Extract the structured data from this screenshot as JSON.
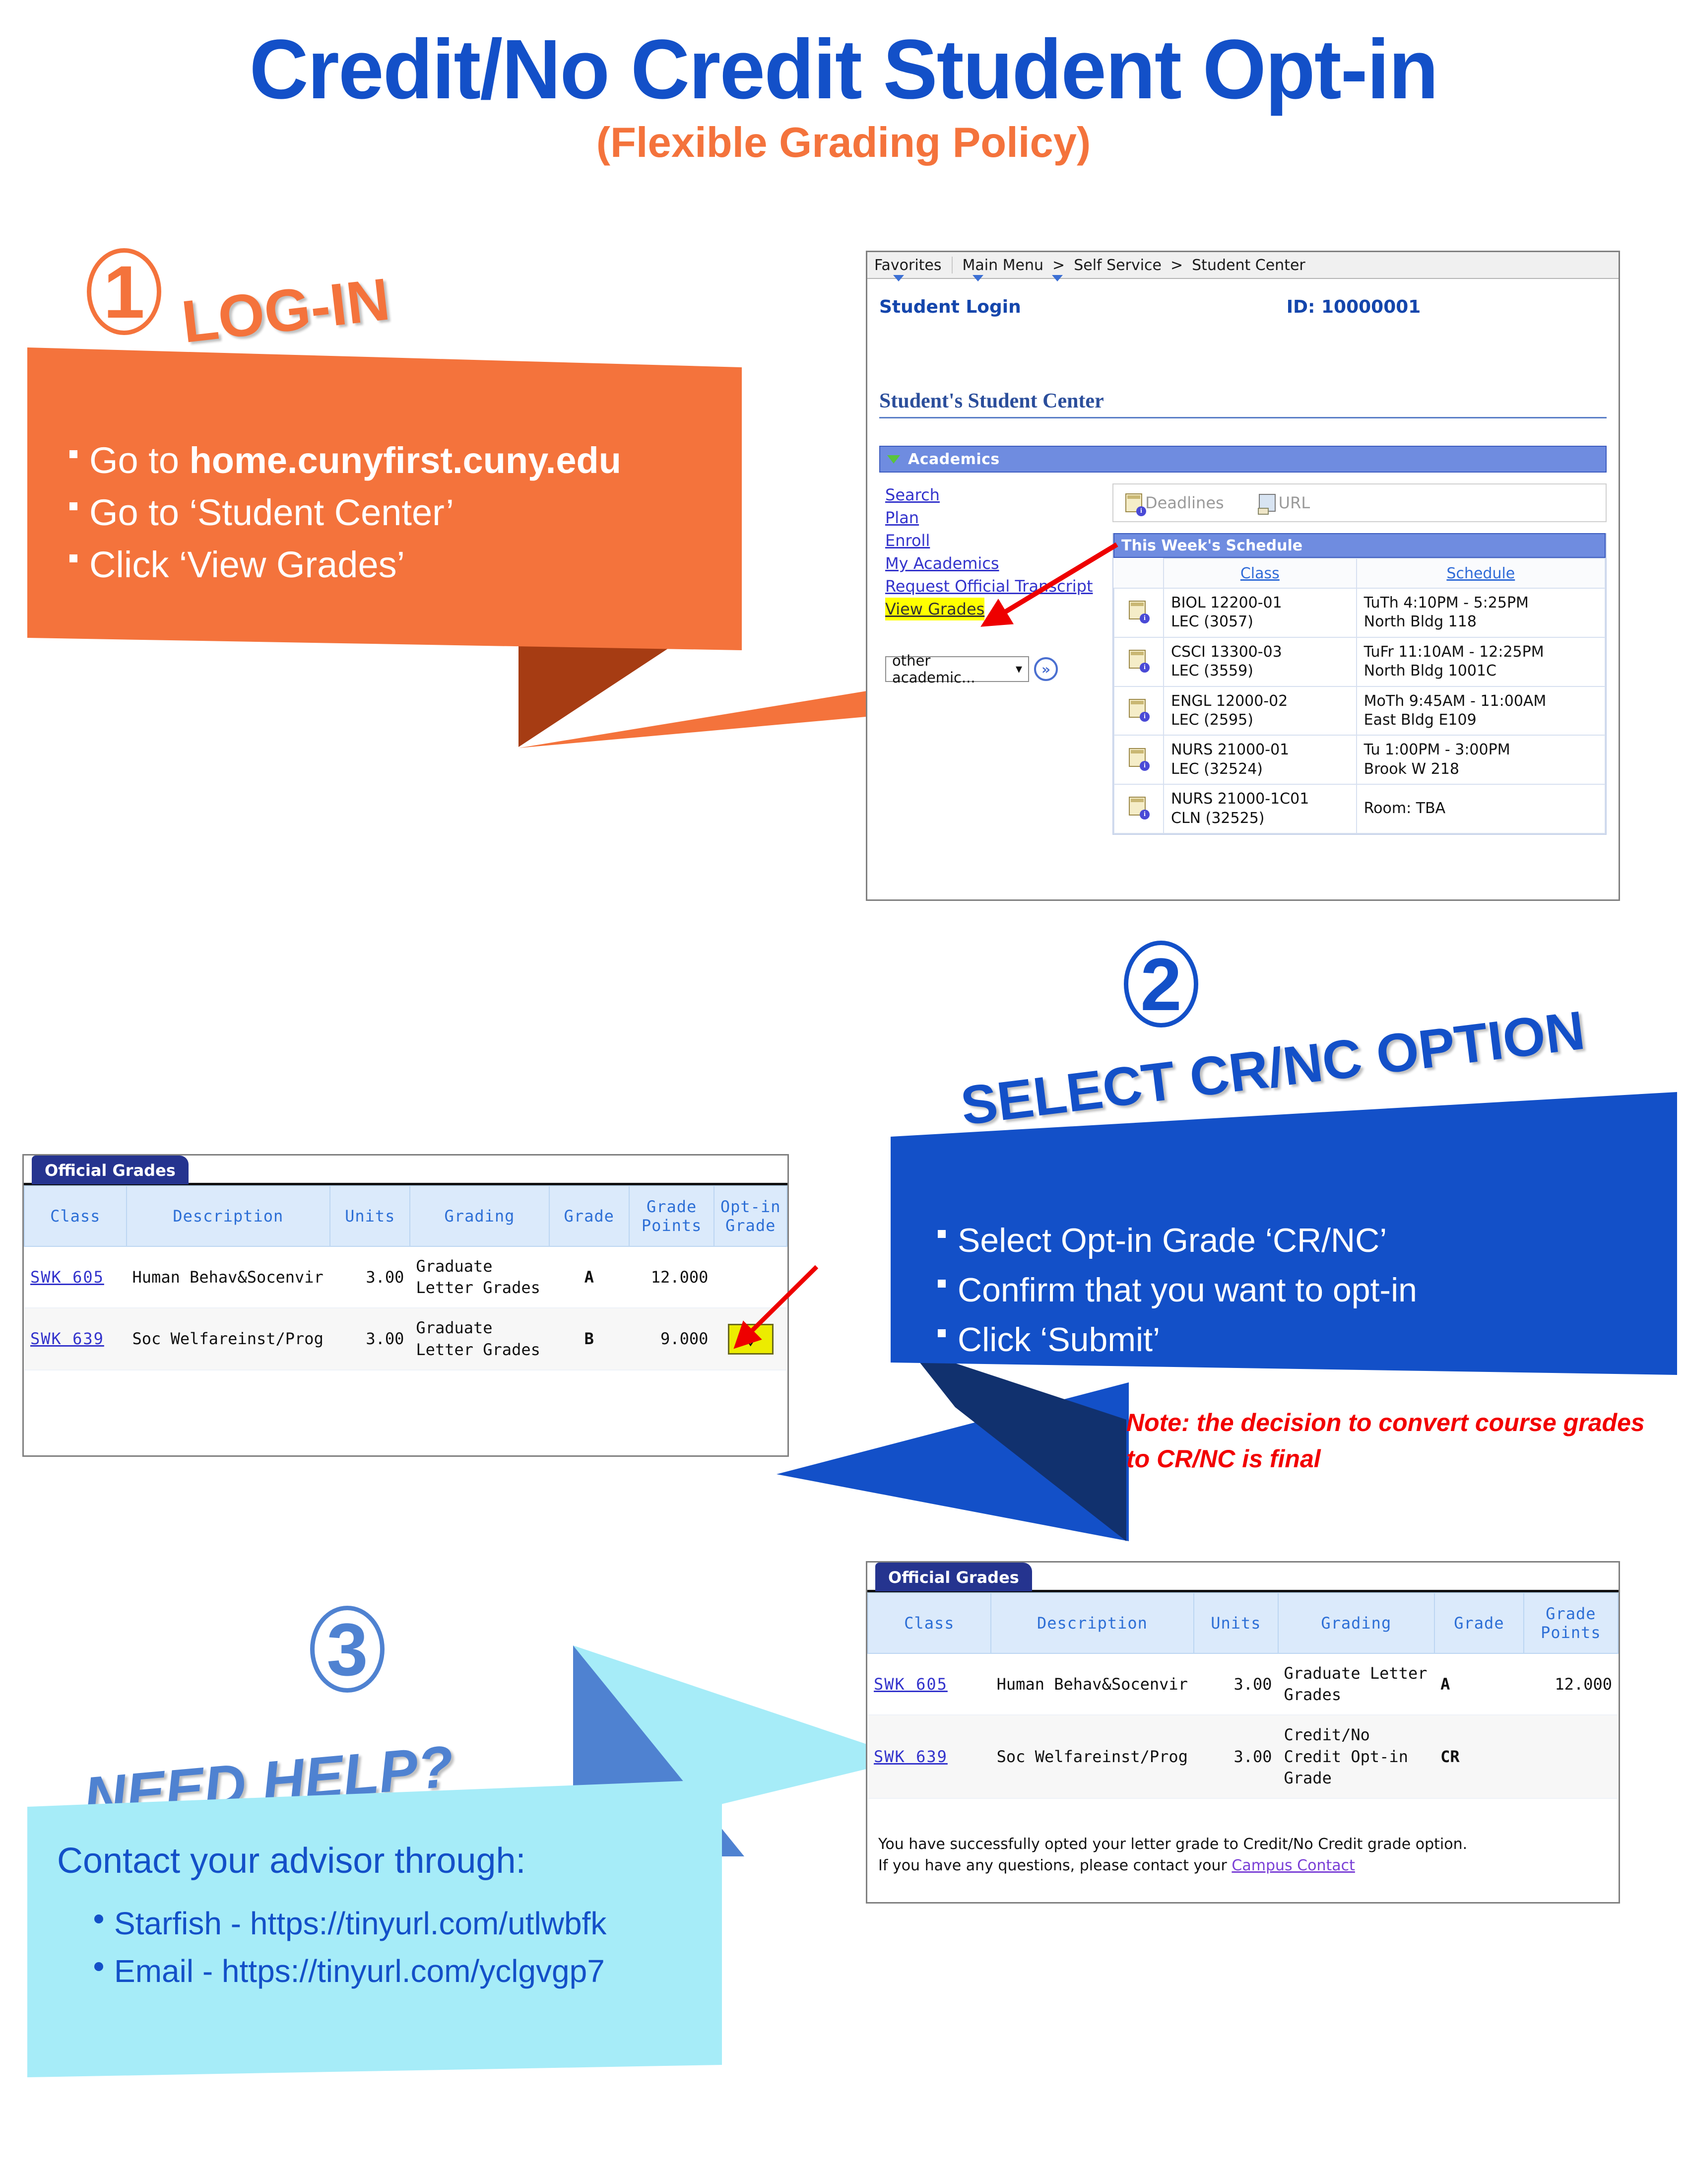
{
  "title": {
    "main": "Credit/No Credit Student Opt-in",
    "sub": "(Flexible Grading Policy)"
  },
  "colors": {
    "title_blue": "#1350c8",
    "title_orange": "#f4733c",
    "step2_blue": "#1350c8",
    "step3_cyan": "#a6ecf8",
    "step3_blue": "#4f82d1",
    "note_red": "#f20000",
    "highlight_yellow": "#ffff00"
  },
  "step1": {
    "number": "1",
    "heading": "LOG-IN",
    "bullets": [
      "Go to home.cunyfirst.cuny.edu",
      "Go to ‘Student Center’",
      "Click ‘View Grades’"
    ],
    "bullet1_prefix": "Go to ",
    "bullet1_bold": "home.cunyfirst.cuny.edu"
  },
  "step2": {
    "number": "2",
    "heading": "SELECT CR/NC OPTION",
    "bullets": [
      "Select Opt-in Grade ‘CR/NC’",
      "Confirm that you want to opt-in",
      "Click ‘Submit’"
    ],
    "note": "Note: the decision to convert course grades to CR/NC is final"
  },
  "step3": {
    "number": "3",
    "heading": "NEED HELP?",
    "contact_heading": "Contact your advisor through:",
    "links": [
      "Starfish - https://tinyurl.com/utlwbfk",
      "Email - https://tinyurl.com/yclgvgp7"
    ]
  },
  "student_center": {
    "breadcrumb": [
      "Favorites",
      "Main Menu",
      "Self Service",
      "Student Center"
    ],
    "crumb_sep": ">",
    "login_label": "Student Login",
    "id_label": "ID:",
    "id_value": "10000001",
    "page_heading": "Student's Student Center",
    "academics_label": "Academics",
    "links": [
      "Search",
      "Plan",
      "Enroll",
      "My Academics",
      "Request Official Transcript",
      "View Grades"
    ],
    "highlighted_link": "View Grades",
    "select_value": "other academic...",
    "go_button": "»",
    "deadlines_label": "Deadlines",
    "url_label": "URL",
    "schedule_title": "This Week's Schedule",
    "schedule_headers": [
      "Class",
      "Schedule"
    ],
    "schedule_rows": [
      {
        "class": "BIOL 12200-01",
        "section": "LEC (3057)",
        "time": "TuTh 4:10PM - 5:25PM",
        "room": "North Bldg 118"
      },
      {
        "class": "CSCI 13300-03",
        "section": "LEC (3559)",
        "time": "TuFr 11:10AM - 12:25PM",
        "room": "North Bldg 1001C"
      },
      {
        "class": "ENGL 12000-02",
        "section": "LEC (2595)",
        "time": "MoTh 9:45AM - 11:00AM",
        "room": "East Bldg E109"
      },
      {
        "class": "NURS 21000-01",
        "section": "LEC (32524)",
        "time": "Tu 1:00PM - 3:00PM",
        "room": "Brook W 218"
      },
      {
        "class": "NURS 21000-1C01",
        "section": "CLN (32525)",
        "time": "Room:  TBA",
        "room": ""
      }
    ]
  },
  "grades_before": {
    "tab_label": "Official Grades",
    "headers": [
      "Class",
      "Description",
      "Units",
      "Grading",
      "Grade",
      "Grade Points",
      "Opt-in Grade"
    ],
    "rows": [
      {
        "class": "SWK 605",
        "description": "Human Behav&Socenvir",
        "units": "3.00",
        "grading": "Graduate Letter Grades",
        "grade": "A",
        "points": "12.000",
        "optin": ""
      },
      {
        "class": "SWK 639",
        "description": "Soc Welfareinst/Prog",
        "units": "3.00",
        "grading": "Graduate Letter Grades",
        "grade": "B",
        "points": "9.000",
        "optin": "dropdown"
      }
    ],
    "dropdown_glyph": "⌄"
  },
  "grades_after": {
    "tab_label": "Official Grades",
    "headers": [
      "Class",
      "Description",
      "Units",
      "Grading",
      "Grade",
      "Grade Points"
    ],
    "rows": [
      {
        "class": "SWK 605",
        "description": "Human Behav&Socenvir",
        "units": "3.00",
        "grading": "Graduate Letter Grades",
        "grade": "A",
        "points": "12.000",
        "highlight": false
      },
      {
        "class": "SWK 639",
        "description": "Soc Welfareinst/Prog",
        "units": "3.00",
        "grading": "Credit/No Credit Opt-in Grade",
        "grade": "CR",
        "points": "",
        "highlight": true
      }
    ],
    "message_line1": "You have successfully opted your letter grade to Credit/No Credit grade option.",
    "message_line2_prefix": "If you have any questions, please contact your ",
    "message_link": "Campus Contact"
  }
}
